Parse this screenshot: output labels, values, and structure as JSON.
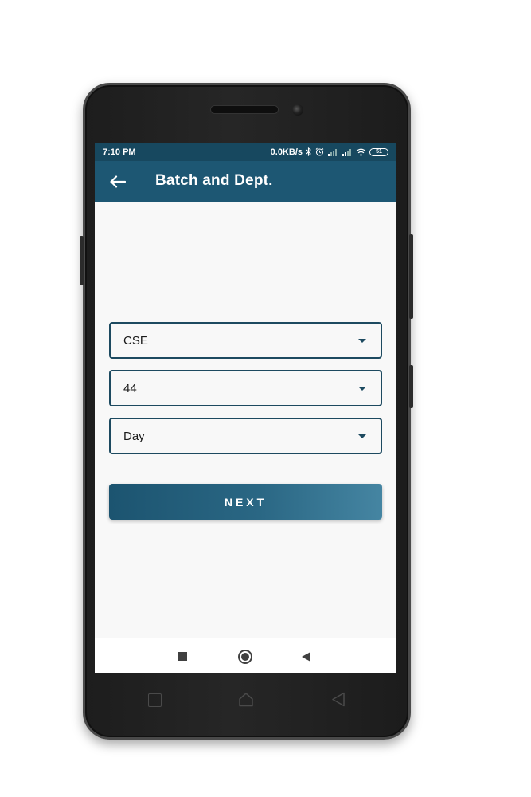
{
  "status_bar": {
    "time": "7:10 PM",
    "network_speed": "0.0KB/s",
    "battery_level": "51",
    "icons": [
      "bluetooth-icon",
      "alarm-icon",
      "signal-icon",
      "signal-icon",
      "wifi-icon",
      "battery-icon"
    ]
  },
  "app_bar": {
    "title": "Batch and Dept.",
    "back_icon": "arrow-left-icon"
  },
  "form": {
    "department": {
      "value": "CSE"
    },
    "batch": {
      "value": "44"
    },
    "shift": {
      "value": "Day"
    },
    "next_label": "NEXT"
  },
  "colors": {
    "primary": "#1d5773",
    "status_bar": "#17485f",
    "button_gradient_start": "#1c5470",
    "button_gradient_end": "#4585a2",
    "dropdown_border": "#1d4a60",
    "screen_background": "#f8f8f8"
  }
}
